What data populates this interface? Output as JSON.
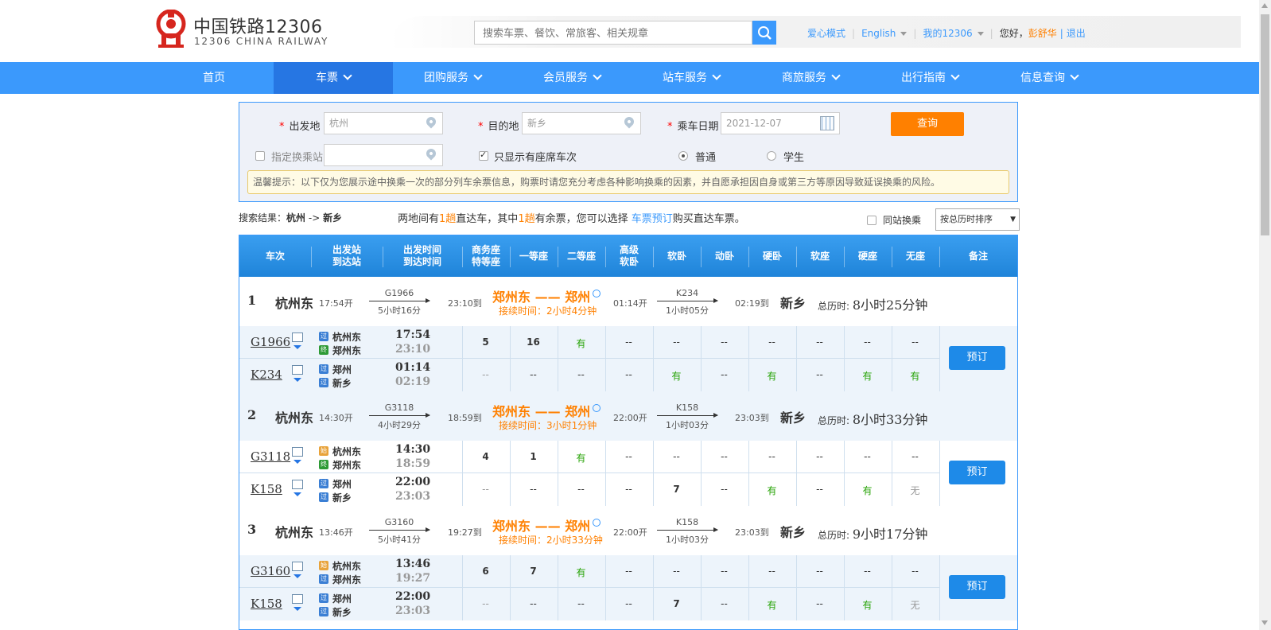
{
  "header": {
    "logo_cn": "中国铁路12306",
    "logo_en": "12306 CHINA RAILWAY",
    "search_placeholder": "搜索车票、餐饮、常旅客、相关规章",
    "links": {
      "care_mode": "爱心模式",
      "english": "English",
      "my12306": "我的12306",
      "greeting": "您好，",
      "username": "彭舒华",
      "logout": "退出"
    }
  },
  "nav": {
    "items": [
      "首页",
      "车票",
      "团购服务",
      "会员服务",
      "站车服务",
      "商旅服务",
      "出行指南",
      "信息查询"
    ],
    "active": "车票"
  },
  "query": {
    "from_label": "出发地",
    "from_value": "杭州",
    "to_label": "目的地",
    "to_value": "新乡",
    "date_label": "乘车日期",
    "date_value": "2021-12-07",
    "search_button": "查询",
    "transfer_label": "指定换乘站",
    "only_seats_label": "只显示有座席车次",
    "only_seats_checked": true,
    "type_normal": "普通",
    "type_student": "学生",
    "tip": "温馨提示：以下仅为您展示途中换乘一次的部分列车余票信息，购票时请您充分考虑各种影响换乘的因素，并自愿承担因自身或第三方等原因导致延误换乘的风险。"
  },
  "result": {
    "prefix": "搜索结果：",
    "route_from": "杭州",
    "route_arrow": "->",
    "route_to": "新乡",
    "desc_1": "两地间有",
    "desc_count_1": "1趟",
    "desc_2": "直达车，其中",
    "desc_count_2": "1趟",
    "desc_3": "有余票，您可以选择",
    "desc_link": "车票预订",
    "desc_4": "购买直达车票。",
    "same_station_label": "同站换乘",
    "sort_value": "按总历时排序"
  },
  "table": {
    "headers": {
      "train": "车次",
      "station_a": "出发站",
      "station_b": "到达站",
      "time_a": "出发时间",
      "time_b": "到达时间",
      "biz_a": "商务座",
      "biz_b": "特等座",
      "first": "一等座",
      "second": "二等座",
      "adv_a": "高级",
      "adv_b": "软卧",
      "soft_sleeper": "软卧",
      "motor_sleeper": "动卧",
      "hard_sleeper": "硬卧",
      "soft_seat": "软座",
      "hard_seat": "硬座",
      "no_seat": "无座",
      "remark": "备注"
    },
    "book_label": "预订",
    "groups": [
      {
        "index": "1",
        "from": "杭州东",
        "depart": "17:54开",
        "train1": "G1966",
        "dur1": "5小时16分",
        "arrive1": "23:10到",
        "transfer": "郑州东 —— 郑州",
        "wait": "接续时间：2小时4分钟",
        "depart2": "01:14开",
        "train2": "K234",
        "dur2": "1小时05分",
        "arrive2": "02:19到",
        "to": "新乡",
        "total_label": "总历时:",
        "total": "8小时25分钟",
        "legs": [
          {
            "train": "G1966",
            "b1": "过",
            "s1": "杭州东",
            "b2": "终",
            "s2": "郑州东",
            "t1": "17:54",
            "t2": "23:10",
            "seats": [
              "5",
              "16",
              "有",
              "--",
              "--",
              "--",
              "--",
              "--",
              "--",
              "--"
            ]
          },
          {
            "train": "K234",
            "b1": "过",
            "s1": "郑州",
            "b2": "过",
            "s2": "新乡",
            "t1": "01:14",
            "t2": "02:19",
            "seats": [
              "--",
              "--",
              "--",
              "--",
              "有",
              "--",
              "有",
              "--",
              "有",
              "有"
            ]
          }
        ]
      },
      {
        "index": "2",
        "from": "杭州东",
        "depart": "14:30开",
        "train1": "G3118",
        "dur1": "4小时29分",
        "arrive1": "18:59到",
        "transfer": "郑州东 —— 郑州",
        "wait": "接续时间：3小时1分钟",
        "depart2": "22:00开",
        "train2": "K158",
        "dur2": "1小时03分",
        "arrive2": "23:03到",
        "to": "新乡",
        "total_label": "总历时:",
        "total": "8小时33分钟",
        "legs": [
          {
            "train": "G3118",
            "b1": "始",
            "s1": "杭州东",
            "b2": "终",
            "s2": "郑州东",
            "t1": "14:30",
            "t2": "18:59",
            "seats": [
              "4",
              "1",
              "有",
              "--",
              "--",
              "--",
              "--",
              "--",
              "--",
              "--"
            ]
          },
          {
            "train": "K158",
            "b1": "过",
            "s1": "郑州",
            "b2": "过",
            "s2": "新乡",
            "t1": "22:00",
            "t2": "23:03",
            "seats": [
              "--",
              "--",
              "--",
              "--",
              "7",
              "--",
              "有",
              "--",
              "有",
              "无"
            ]
          }
        ]
      },
      {
        "index": "3",
        "from": "杭州东",
        "depart": "13:46开",
        "train1": "G3160",
        "dur1": "5小时41分",
        "arrive1": "19:27到",
        "transfer": "郑州东 —— 郑州",
        "wait": "接续时间：2小时33分钟",
        "depart2": "22:00开",
        "train2": "K158",
        "dur2": "1小时03分",
        "arrive2": "23:03到",
        "to": "新乡",
        "total_label": "总历时:",
        "total": "9小时17分钟",
        "legs": [
          {
            "train": "G3160",
            "b1": "始",
            "s1": "杭州东",
            "b2": "过",
            "s2": "郑州东",
            "t1": "13:46",
            "t2": "19:27",
            "seats": [
              "6",
              "7",
              "有",
              "--",
              "--",
              "--",
              "--",
              "--",
              "--",
              "--"
            ]
          },
          {
            "train": "K158",
            "b1": "过",
            "s1": "郑州",
            "b2": "过",
            "s2": "新乡",
            "t1": "22:00",
            "t2": "23:03",
            "seats": [
              "--",
              "--",
              "--",
              "--",
              "7",
              "--",
              "有",
              "--",
              "有",
              "无"
            ]
          }
        ]
      }
    ]
  },
  "colors": {
    "brand_blue": "#3b99fc",
    "nav_active": "#2676e3",
    "accent_orange": "#ff8000",
    "available_green": "#26a306",
    "logo_red": "#d6261e"
  }
}
